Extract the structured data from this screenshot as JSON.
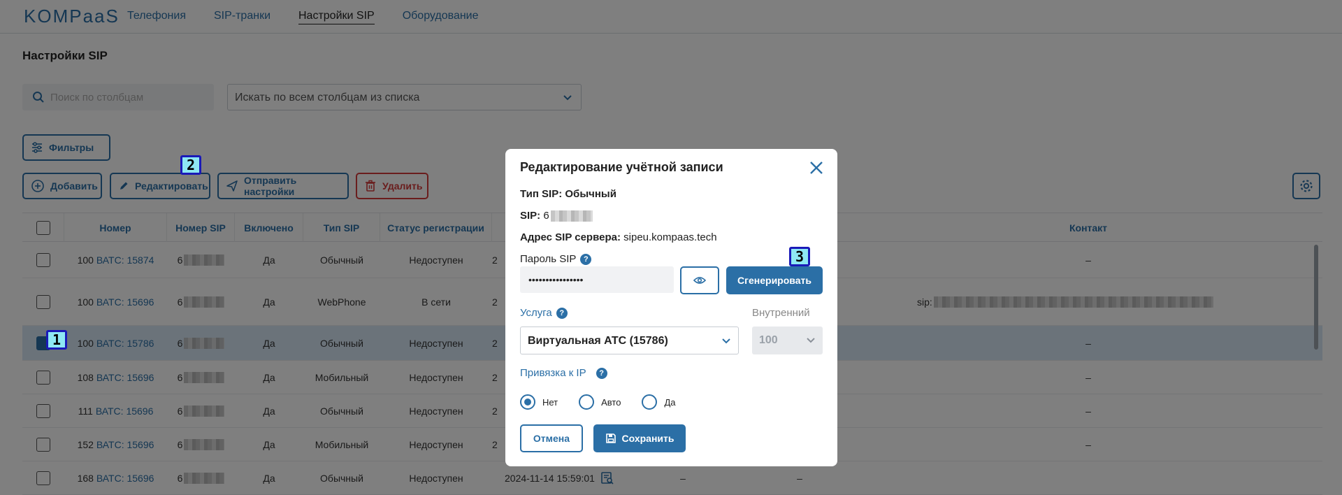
{
  "header": {
    "logo": "KOMPaaS",
    "nav": [
      {
        "label": "Телефония"
      },
      {
        "label": "SIP-транки"
      },
      {
        "label": "Настройки SIP",
        "active": true
      },
      {
        "label": "Оборудование"
      }
    ]
  },
  "page": {
    "title": "Настройки SIP",
    "search_placeholder": "Поиск по столбцам",
    "column_select": "Искать по всем столбцам из списка"
  },
  "toolbar": {
    "filters": "Фильтры",
    "add": "Добавить",
    "edit": "Редактировать",
    "send": "Отправить настройки",
    "delete": "Удалить"
  },
  "table": {
    "headers": [
      "Номер",
      "Номер SIP",
      "Включено",
      "Тип SIP",
      "Статус регистрации",
      "Контакт"
    ],
    "rows": [
      {
        "num": "100",
        "vats": "ВАТС: 15874",
        "sip": "6",
        "enabled": "Да",
        "type": "Обычный",
        "status": "Недоступен",
        "date": "2",
        "contact": "–"
      },
      {
        "num": "100",
        "vats": "ВАТС: 15696",
        "sip": "6",
        "enabled": "Да",
        "type": "WebPhone",
        "status": "В сети",
        "date": "2",
        "contact": "sip:"
      },
      {
        "num": "100",
        "vats": "ВАТС: 15786",
        "sip": "6",
        "enabled": "Да",
        "type": "Обычный",
        "status": "Недоступен",
        "date": "2",
        "contact": "–",
        "selected": true
      },
      {
        "num": "108",
        "vats": "ВАТС: 15696",
        "sip": "6",
        "enabled": "Да",
        "type": "Мобильный",
        "status": "Недоступен",
        "date": "2",
        "contact": "–"
      },
      {
        "num": "111",
        "vats": "ВАТС: 15696",
        "sip": "6",
        "enabled": "Да",
        "type": "Обычный",
        "status": "Недоступен",
        "date": "2",
        "contact": "–"
      },
      {
        "num": "152",
        "vats": "ВАТС: 15696",
        "sip": "6",
        "enabled": "Да",
        "type": "Мобильный",
        "status": "Недоступен",
        "date": "2",
        "contact": "–"
      },
      {
        "num": "168",
        "vats": "ВАТС: 15696",
        "sip": "6",
        "enabled": "Да",
        "type": "Обычный",
        "status": "Недоступен",
        "date": "2024-11-14 15:59:01",
        "dash1": "–",
        "dash2": "–",
        "contact": ""
      }
    ]
  },
  "modal": {
    "title": "Редактирование учётной записи",
    "type_label": "Тип SIP:",
    "type_value": "Обычный",
    "sip_label": "SIP:",
    "sip_value": "6",
    "server_label": "Адрес SIP сервера:",
    "server_value": "sipeu.kompaas.tech",
    "password_label": "Пароль SIP",
    "password_value": "••••••••••••••••",
    "help": "?",
    "generate": "Сгенерировать",
    "service_label": "Услуга",
    "service_value": "Виртуальная АТС (15786)",
    "internal_label": "Внутренний",
    "internal_value": "100",
    "ip_label": "Привязка к IP",
    "ip_options": [
      "Нет",
      "Авто",
      "Да"
    ],
    "ip_selected": "Нет",
    "cancel": "Отмена",
    "save": "Сохранить"
  },
  "markers": [
    "1",
    "2",
    "3"
  ],
  "colors": {
    "accent": "#2b6fa6",
    "danger": "#d43a3a",
    "marker_bg": "#8ee8f4",
    "marker_border": "#1a1ab8"
  }
}
